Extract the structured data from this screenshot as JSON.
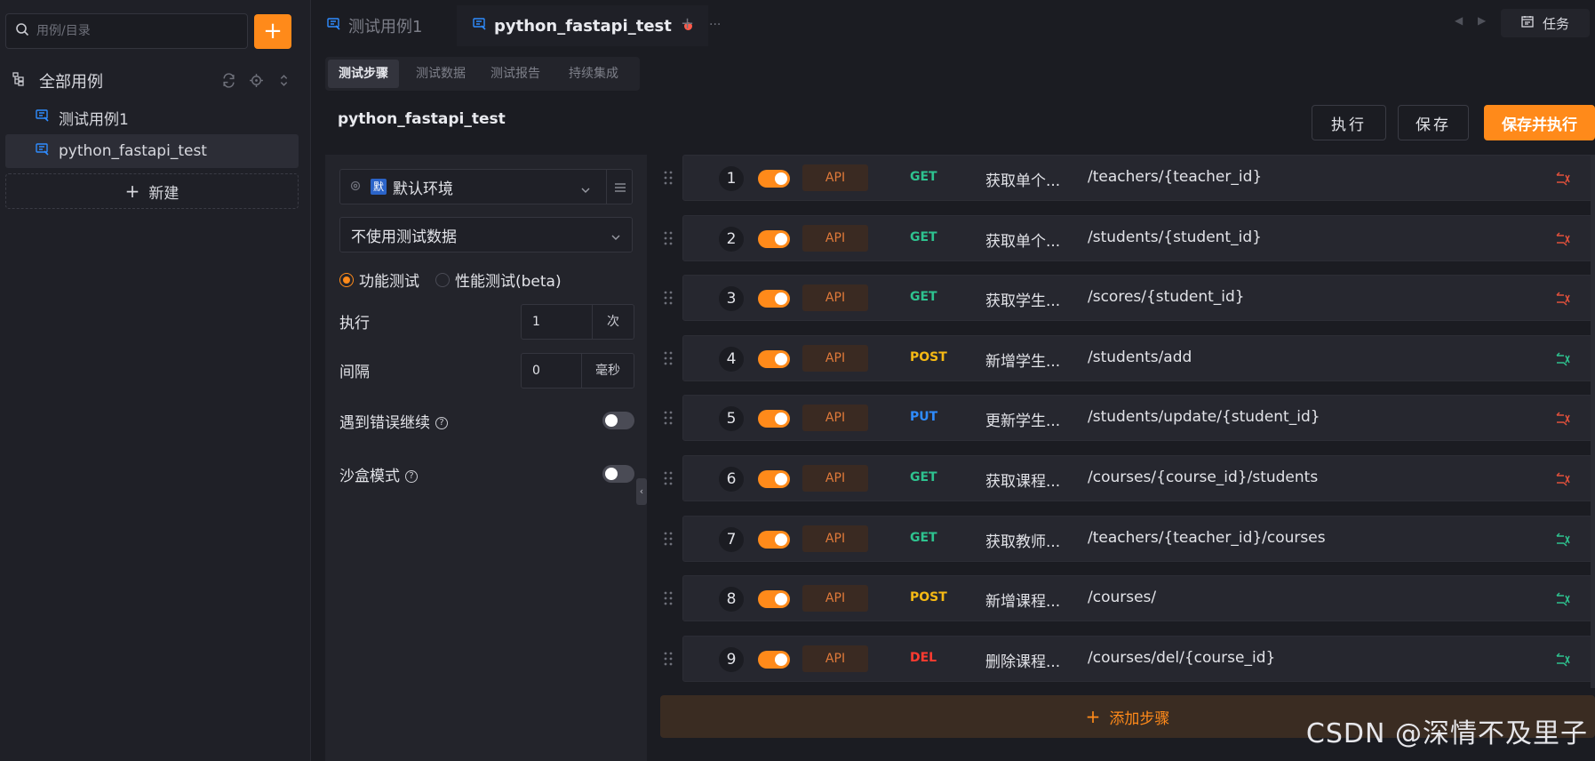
{
  "sidebar": {
    "search_placeholder": "用例/目录",
    "add_label": "+",
    "root_label": "全部用例",
    "items": [
      {
        "label": "测试用例1"
      },
      {
        "label": "python_fastapi_test"
      }
    ],
    "new_label": "新建"
  },
  "tabs": [
    {
      "label": "测试用例1"
    },
    {
      "label": "python_fastapi_test"
    }
  ],
  "tab_controls": {
    "add": "+",
    "more": "···"
  },
  "task_label": "任务",
  "subtabs": [
    "测试步骤",
    "测试数据",
    "测试报告",
    "持续集成"
  ],
  "case": {
    "title": "python_fastapi_test",
    "run_label": "执行",
    "save_label": "保存",
    "save_run_label": "保存并执行"
  },
  "config": {
    "env_badge": "默",
    "env_label": "默认环境",
    "data_select": "不使用测试数据",
    "mode_functional": "功能测试",
    "mode_performance": "性能测试(beta)",
    "run_label": "执行",
    "run_count": "1",
    "run_unit": "次",
    "interval_label": "间隔",
    "interval_value": "0",
    "interval_unit": "毫秒",
    "continue_on_error": "遇到错误继续",
    "sandbox_mode": "沙盒模式"
  },
  "steps": [
    {
      "num": "1",
      "tag": "API",
      "method": "GET",
      "name": "获取单个...",
      "path": "/teachers/{teacher_id}",
      "status": "fail"
    },
    {
      "num": "2",
      "tag": "API",
      "method": "GET",
      "name": "获取单个...",
      "path": "/students/{student_id}",
      "status": "fail"
    },
    {
      "num": "3",
      "tag": "API",
      "method": "GET",
      "name": "获取学生...",
      "path": "/scores/{student_id}",
      "status": "fail"
    },
    {
      "num": "4",
      "tag": "API",
      "method": "POST",
      "name": "新增学生...",
      "path": "/students/add",
      "status": "pass"
    },
    {
      "num": "5",
      "tag": "API",
      "method": "PUT",
      "name": "更新学生...",
      "path": "/students/update/{student_id}",
      "status": "fail"
    },
    {
      "num": "6",
      "tag": "API",
      "method": "GET",
      "name": "获取课程...",
      "path": "/courses/{course_id}/students",
      "status": "fail"
    },
    {
      "num": "7",
      "tag": "API",
      "method": "GET",
      "name": "获取教师...",
      "path": "/teachers/{teacher_id}/courses",
      "status": "pass"
    },
    {
      "num": "8",
      "tag": "API",
      "method": "POST",
      "name": "新增课程...",
      "path": "/courses/",
      "status": "pass"
    },
    {
      "num": "9",
      "tag": "API",
      "method": "DEL",
      "name": "删除课程...",
      "path": "/courses/del/{course_id}",
      "status": "pass"
    }
  ],
  "add_step_label": "添加步骤",
  "colors": {
    "accent": "#ff8a1a",
    "get": "#2ec28f",
    "post": "#f5b914",
    "put": "#2f8cff",
    "del": "#ff3b30",
    "fail": "#e0503c",
    "pass": "#2ec28f"
  },
  "watermark": "CSDN @深情不及里子"
}
